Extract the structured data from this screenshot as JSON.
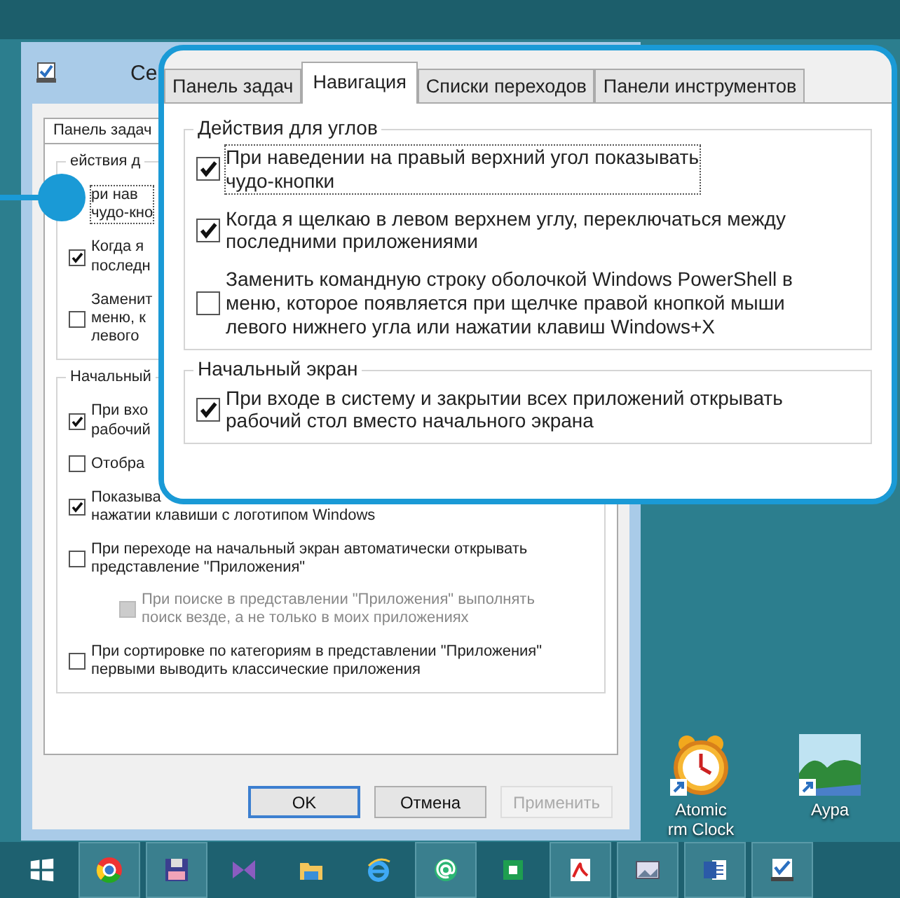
{
  "desktop_icons": [
    {
      "kind": "clock",
      "lines": [
        "Atomic",
        "rm Clock"
      ]
    },
    {
      "kind": "landscape",
      "lines": [
        "Аура"
      ]
    }
  ],
  "dialog": {
    "title": "Се",
    "tabs": [
      {
        "label": "Панель задач",
        "selected": true
      }
    ],
    "groups": [
      {
        "legend": "ействия д",
        "items": [
          {
            "lines": [
              "ри нав",
              "чудо-кно"
            ],
            "focused": true
          },
          {
            "lines": [
              "Когда я",
              "последн"
            ],
            "checked": true
          },
          {
            "lines": [
              "Заменит",
              "меню, к",
              "левого"
            ],
            "checked": false
          }
        ]
      },
      {
        "legend": "Начальный",
        "items": [
          {
            "lines": [
              "При вхо",
              "рабочий"
            ],
            "checked": true
          },
          {
            "lines": [
              "Отобра"
            ],
            "checked": false
          },
          {
            "lines": [
              "Показыва",
              "нажатии клавиши с логотипом Windows"
            ],
            "checked": true
          },
          {
            "lines": [
              "При переходе на начальный экран автоматически открывать",
              "представление \"Приложения\""
            ],
            "checked": false,
            "children": [
              {
                "lines": [
                  "При поиске в представлении \"Приложения\" выполнять",
                  "поиск везде, а не только в моих приложениях"
                ],
                "checked": false,
                "disabled": true
              }
            ]
          },
          {
            "lines": [
              "При сортировке по категориям в представлении \"Приложения\"",
              "первыми выводить классические приложения"
            ],
            "checked": false
          }
        ]
      }
    ],
    "buttons": [
      {
        "label": "OK",
        "default": true,
        "disabled": false
      },
      {
        "label": "Отмена",
        "default": false,
        "disabled": false
      },
      {
        "label": "Применить",
        "default": false,
        "disabled": true
      }
    ]
  },
  "callout": {
    "tabs": [
      {
        "label": "Панель задач",
        "selected": false
      },
      {
        "label": "Навигация",
        "selected": true
      },
      {
        "label": "Списки переходов",
        "selected": false
      },
      {
        "label": "Панели инструментов",
        "selected": false
      }
    ],
    "groups": [
      {
        "legend": "Действия для углов",
        "items": [
          {
            "lines": [
              "При наведении на правый верхний угол показывать",
              "чудо-кнопки"
            ],
            "checked": true,
            "focused": true
          },
          {
            "lines": [
              "Когда я щелкаю в левом верхнем углу, переключаться между",
              "последними приложениями"
            ],
            "checked": true
          },
          {
            "lines": [
              "Заменить командную строку оболочкой Windows PowerShell в",
              "меню, которое появляется при щелчке правой кнопкой мыши",
              "левого нижнего угла или нажатии клавиш Windows+X"
            ],
            "checked": false
          }
        ]
      },
      {
        "legend": "Начальный экран",
        "items": [
          {
            "lines": [
              "При входе в систему и закрытии всех приложений открывать",
              "рабочий стол вместо начального экрана"
            ],
            "checked": true
          }
        ]
      }
    ]
  },
  "taskbar": [
    {
      "kind": "start",
      "running": false
    },
    {
      "kind": "chrome",
      "running": true
    },
    {
      "kind": "floppy",
      "running": true
    },
    {
      "kind": "bowtie",
      "running": false
    },
    {
      "kind": "folder",
      "running": false
    },
    {
      "kind": "ie",
      "running": false
    },
    {
      "kind": "at",
      "running": true
    },
    {
      "kind": "office",
      "running": false
    },
    {
      "kind": "pdf",
      "running": true
    },
    {
      "kind": "picture",
      "running": true
    },
    {
      "kind": "word",
      "running": true
    },
    {
      "kind": "checklist",
      "running": true
    }
  ]
}
